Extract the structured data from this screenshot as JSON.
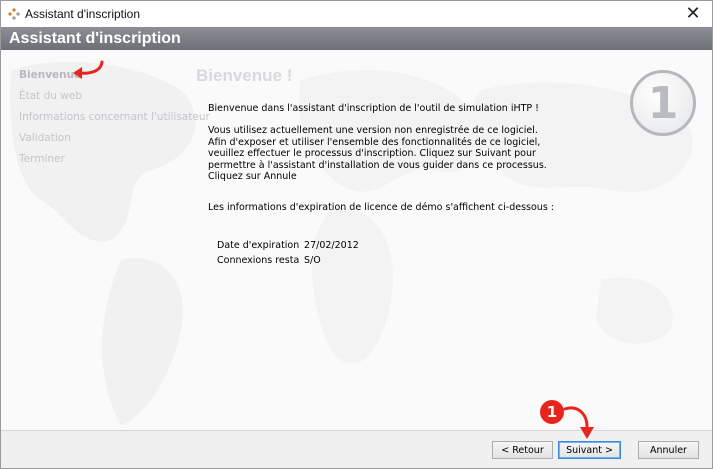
{
  "window": {
    "title": "Assistant d'inscription"
  },
  "header": {
    "title": "Assistant d'inscription"
  },
  "sidebar": {
    "items": [
      {
        "label": "Bienvenue",
        "active": true
      },
      {
        "label": "État du web",
        "active": false
      },
      {
        "label": "Informations concernant l'utilisateur",
        "active": false
      },
      {
        "label": "Validation",
        "active": false
      },
      {
        "label": "Terminer",
        "active": false
      }
    ]
  },
  "main": {
    "title": "Bienvenue !",
    "step_number": "1",
    "paragraphs": [
      "Bienvenue dans l'assistant d'inscription de l'outil de simulation iHTP !",
      "Vous utilisez actuellement une version non enregistrée de ce logiciel. Afin d'exposer et utiliser l'ensemble des fonctionnalités de ce logiciel, veuillez effectuer le processus d'inscription. Cliquez sur Suivant pour permettre à l'assistant d'installation de vous guider dans ce processus. Cliquez sur Annule",
      "Les informations d'expiration de licence de démo s'affichent ci-dessous :"
    ],
    "info": [
      {
        "label": "Date d'expiration",
        "value": "27/02/2012"
      },
      {
        "label": "Connexions resta",
        "value": "S/O"
      }
    ]
  },
  "footer": {
    "back_label": "< Retour",
    "next_label": "Suivant >",
    "cancel_label": "Annuler"
  },
  "annotation": {
    "badge_number": "1",
    "color": "#e8251c"
  },
  "colors": {
    "header_bg": "#7a7d83",
    "accent": "#e8251c",
    "next_border": "#3b8ad9"
  }
}
